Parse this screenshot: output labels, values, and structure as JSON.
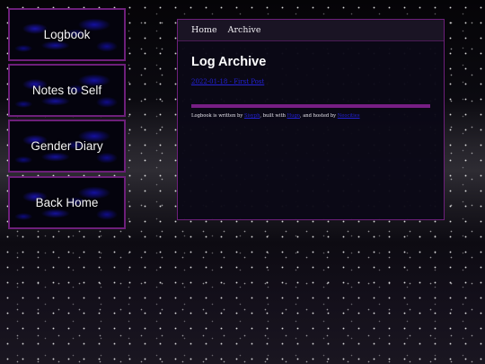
{
  "sidebar": {
    "items": [
      {
        "label": "Logbook"
      },
      {
        "label": "Notes to Self"
      },
      {
        "label": "Gender Diary"
      },
      {
        "label": "Back Home"
      }
    ]
  },
  "topnav": {
    "home": "Home",
    "archive": "Archive"
  },
  "main": {
    "title": "Log Archive",
    "posts": [
      {
        "label": "2022-01-18 - First Post"
      }
    ]
  },
  "footer": {
    "text_1": "Logbook is written by ",
    "author": "Sisyph",
    "text_2": ", built with ",
    "tool": "Hugo",
    "text_3": ", and hosted by ",
    "host": "Neocities"
  },
  "colors": {
    "accent": "#771e84",
    "link": "#2321d6",
    "tile_border": "#6d1f7a"
  }
}
